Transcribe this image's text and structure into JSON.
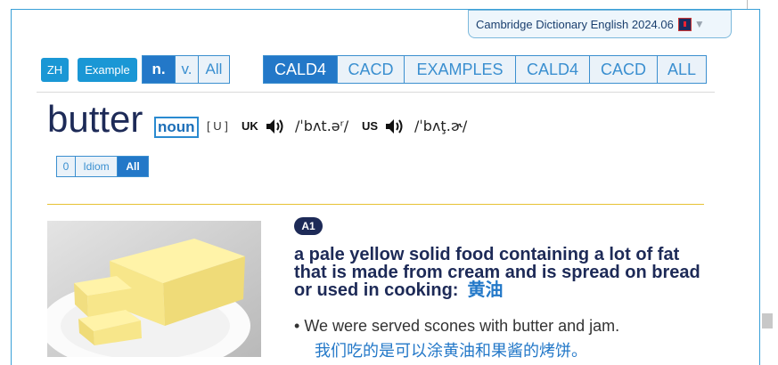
{
  "dictionary_selector": {
    "label": "Cambridge Dictionary English 2024.06"
  },
  "left_buttons": {
    "zh": "ZH",
    "example": "Example"
  },
  "pos_tabs": [
    "n.",
    "v.",
    "All"
  ],
  "source_tabs": [
    "CALD4",
    "CACD",
    "EXAMPLES",
    "CALD4",
    "CACD",
    "ALL"
  ],
  "entry": {
    "headword": "butter",
    "pos": "noun",
    "grammar": "[ U ]",
    "uk_label": "UK",
    "uk_ipa": "/ˈbʌt.əʳ/",
    "us_label": "US",
    "us_ipa": "/ˈbʌţ.ɚ/"
  },
  "filter_tabs": [
    "0",
    "Idiom",
    "All"
  ],
  "sense": {
    "level": "A1",
    "definition": "a pale yellow solid food containing a lot of fat that is made from cream and is spread on bread or used in cooking:",
    "definition_zh": "黄油",
    "example": "We were served scones with butter and jam.",
    "example_zh": "我们吃的是可以涂黄油和果酱的烤饼。"
  },
  "colors": {
    "accent": "#2378c8",
    "navy": "#1d2a57",
    "gold": "#e7c233"
  }
}
